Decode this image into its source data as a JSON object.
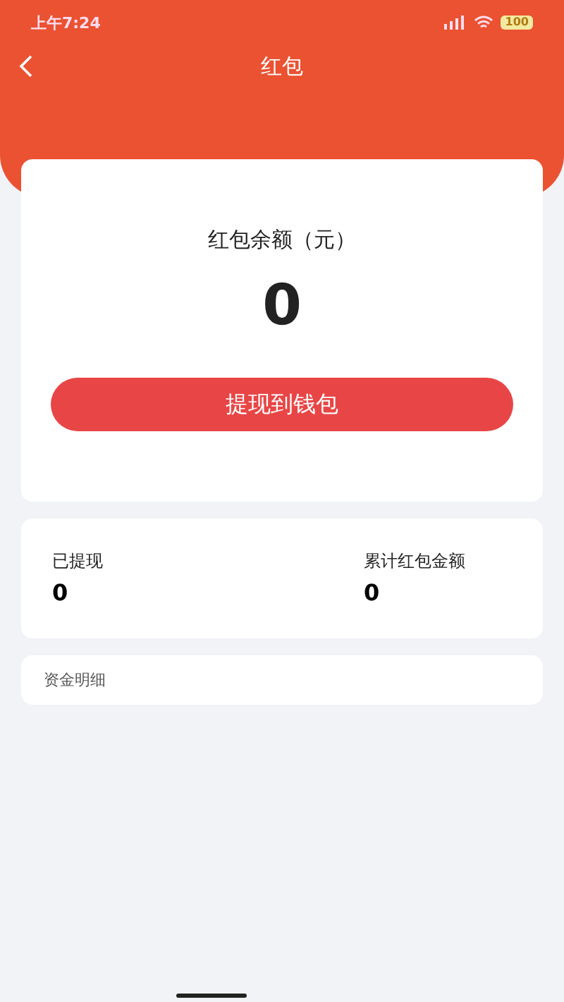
{
  "status_bar": {
    "time": "上午7:24",
    "battery": "100"
  },
  "nav_bar": {
    "title": "红包"
  },
  "balance_card": {
    "label": "红包余额（元）",
    "amount": "0",
    "button": "提现到钱包"
  },
  "stats": [
    {
      "label": "已提现",
      "value": "0"
    },
    {
      "label": "累计红包金额",
      "value": "0"
    }
  ],
  "details": {
    "title": "资金明细"
  }
}
